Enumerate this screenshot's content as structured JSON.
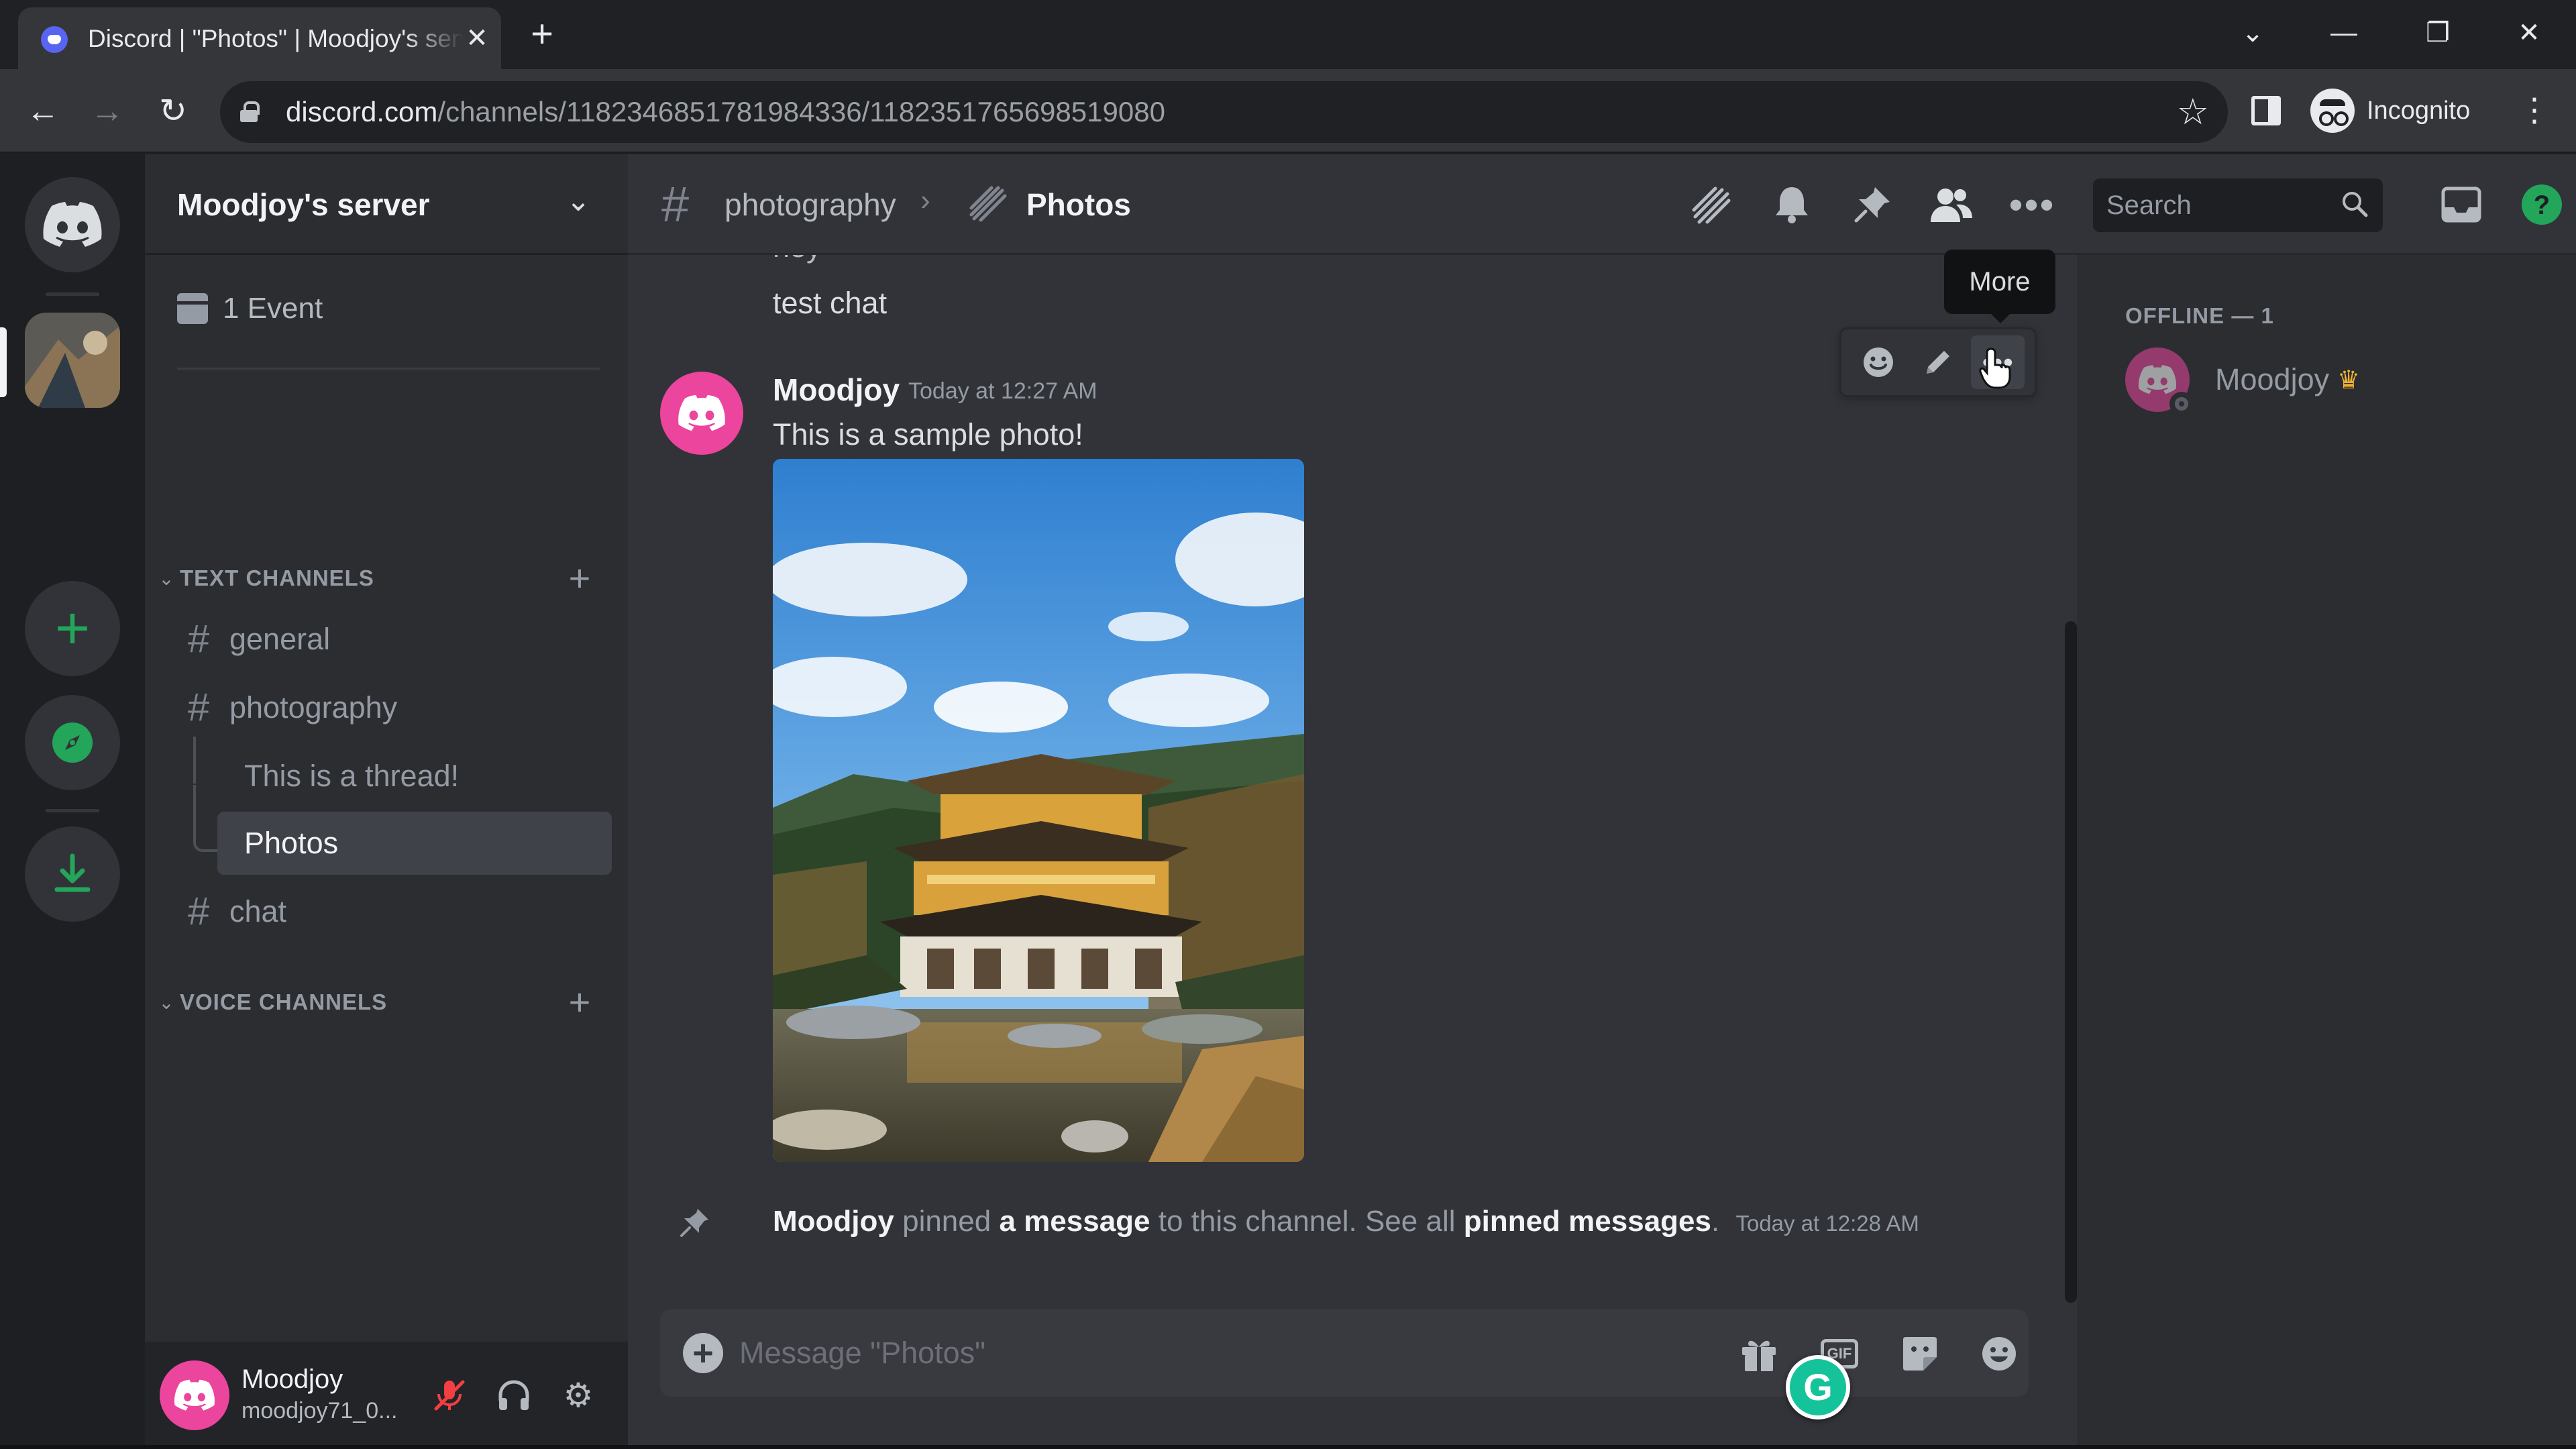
{
  "browser": {
    "tab_title": "Discord | \"Photos\" | Moodjoy's server",
    "url_host": "discord.com",
    "url_path": "/channels/1182346851781984336/1182351765698519080",
    "profile_label": "Incognito"
  },
  "server": {
    "name": "Moodjoy's server",
    "event_label": "1 Event"
  },
  "categories": {
    "text": "TEXT CHANNELS",
    "voice": "VOICE CHANNELS"
  },
  "channels": {
    "general": "general",
    "photography": "photography",
    "thread": "This is a thread!",
    "photos": "Photos",
    "chat": "chat"
  },
  "user_panel": {
    "name": "Moodjoy",
    "tag": "moodjoy71_0..."
  },
  "header": {
    "parent": "photography",
    "title": "Photos",
    "search_placeholder": "Search"
  },
  "messages": {
    "prev_line_1": "hey",
    "prev_line_2": "test chat",
    "author": "Moodjoy",
    "time": "Today at 12:27 AM",
    "text": "This is a sample photo!"
  },
  "tooltip": "More",
  "pin_notice": {
    "author": "Moodjoy",
    "t1": "pinned",
    "link1": "a message",
    "t2": "to this channel. See all",
    "link2": "pinned messages",
    "t3": ".",
    "time": "Today at 12:28 AM"
  },
  "composer": {
    "placeholder": "Message \"Photos\"",
    "gif": "GIF"
  },
  "members": {
    "heading": "OFFLINE — 1",
    "name": "Moodjoy"
  },
  "colors": {
    "blurple": "#5865f2",
    "avatar_pink": "#eb459e",
    "green": "#23a55a",
    "bg_main": "#313338",
    "bg_sidebar": "#2b2d31",
    "bg_guilds": "#1e1f22"
  }
}
